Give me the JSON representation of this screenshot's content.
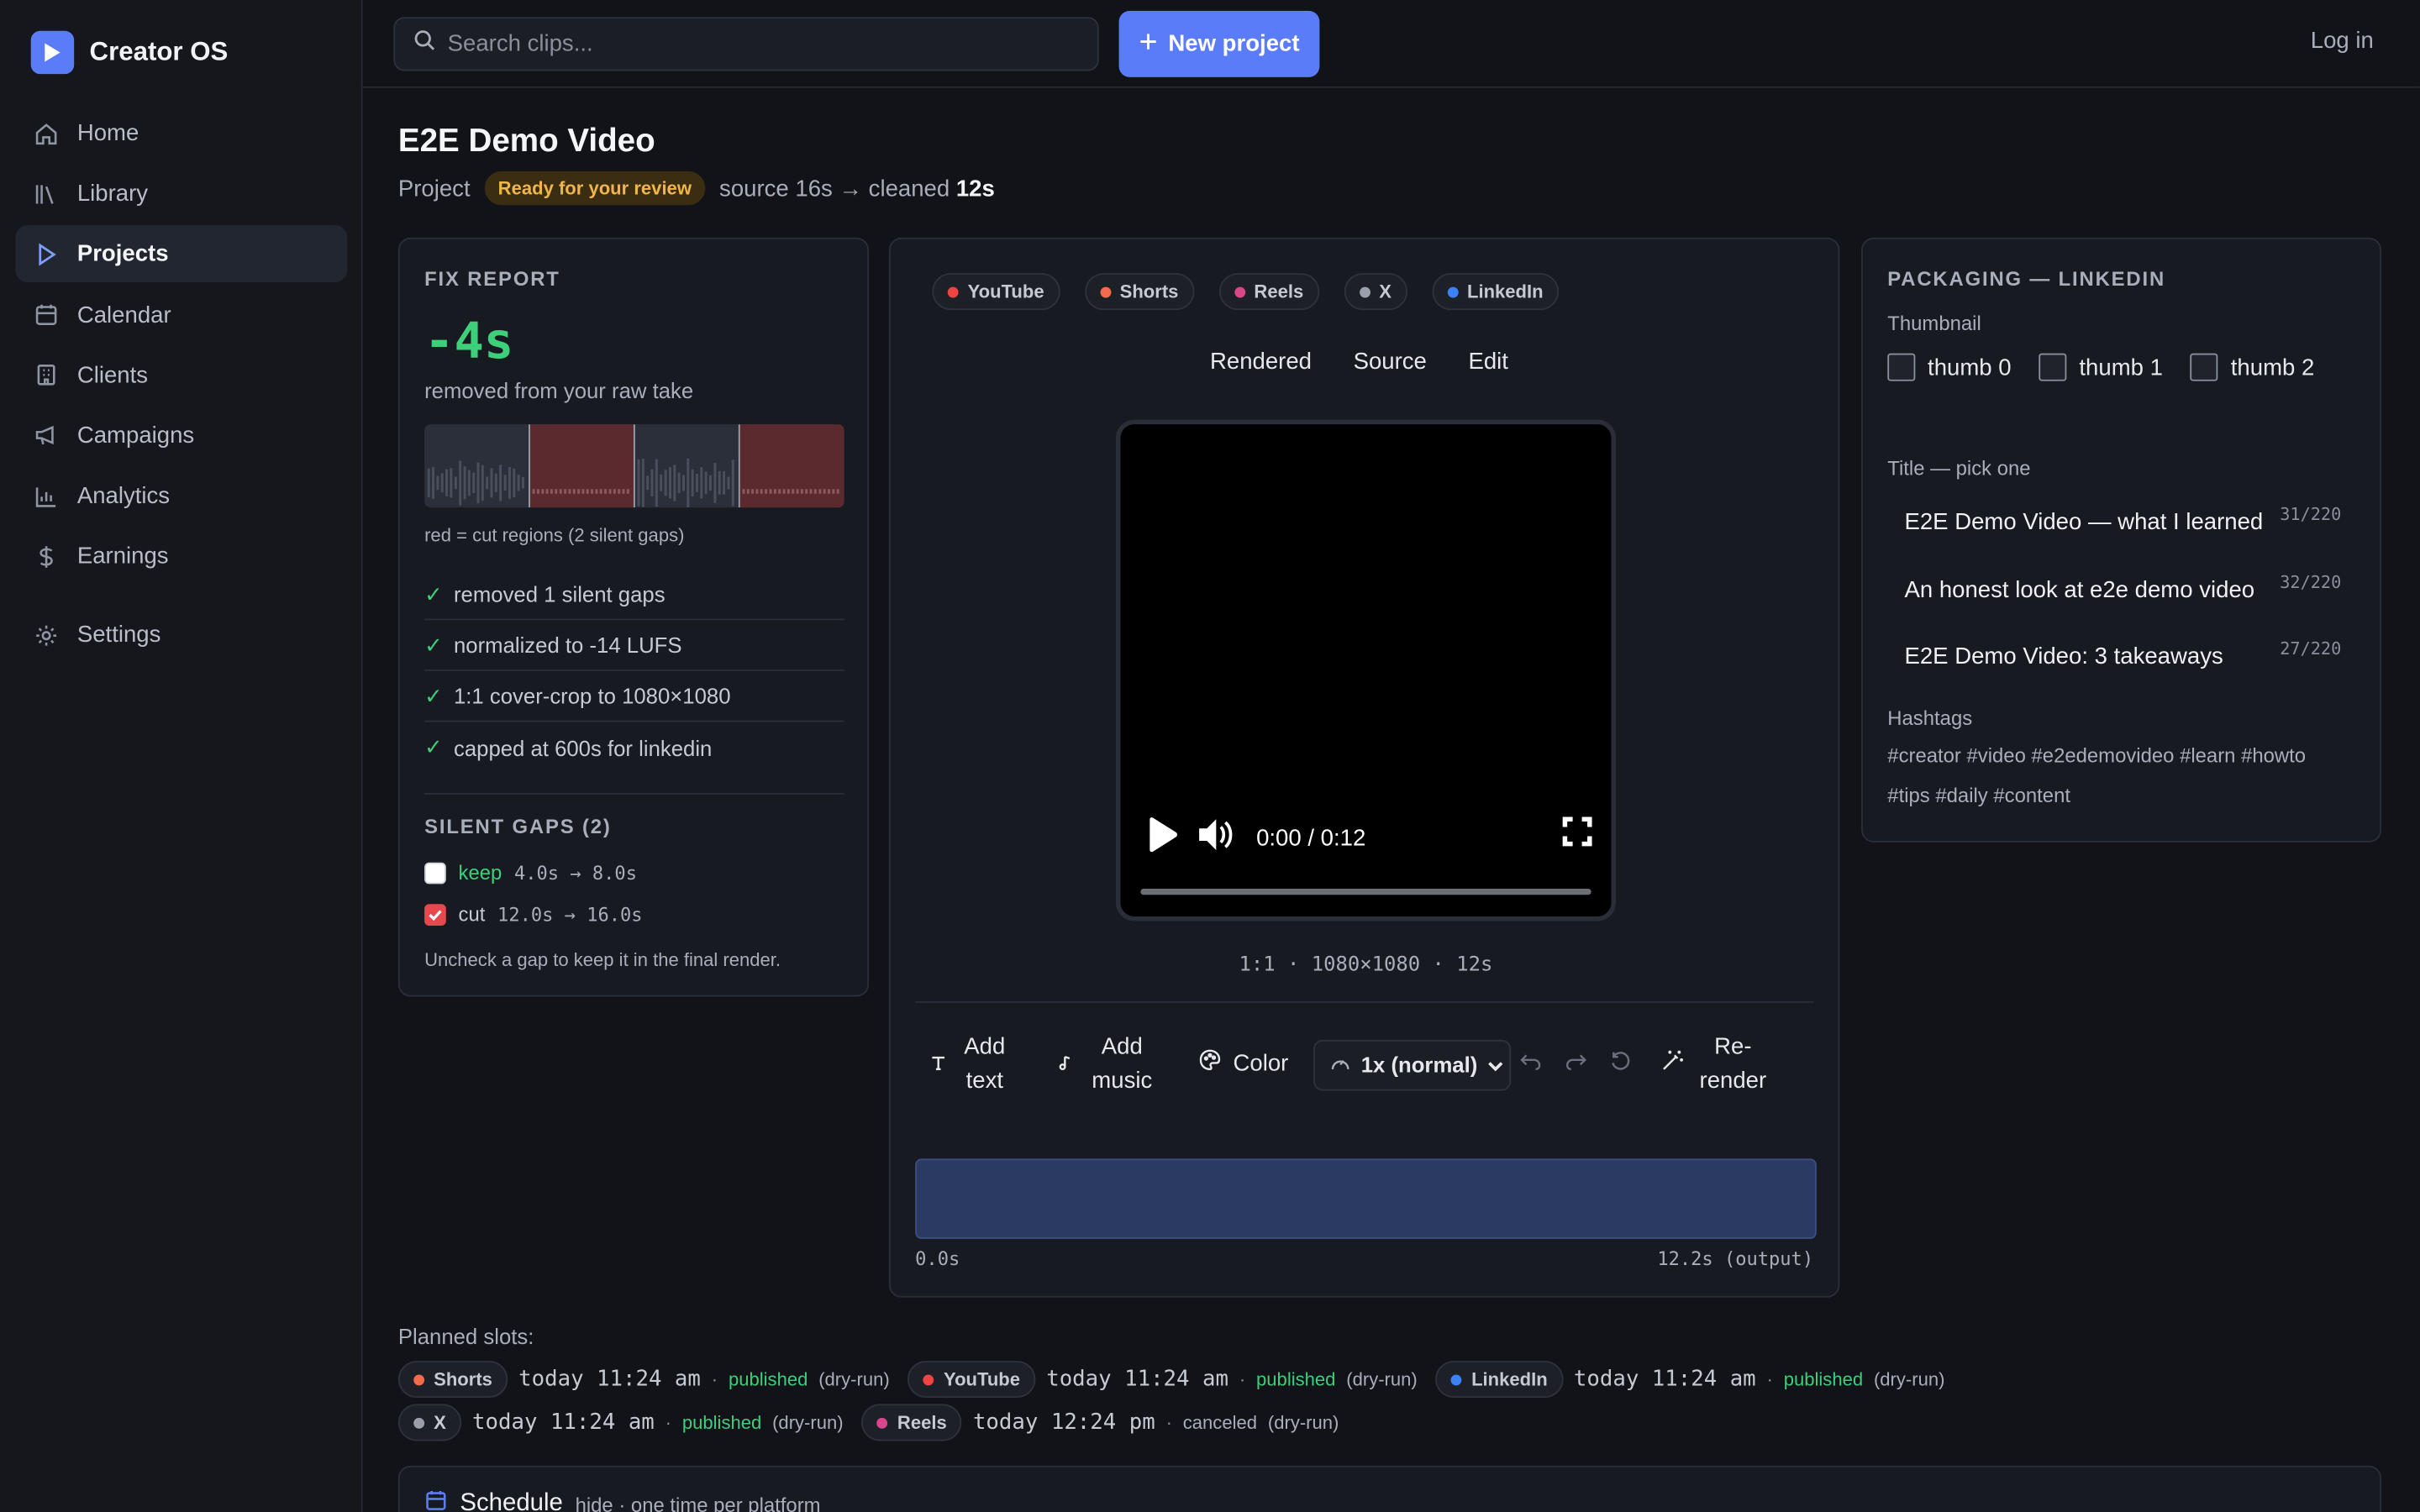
{
  "app": {
    "name": "Creator OS"
  },
  "sidebar": {
    "items": [
      {
        "label": "Home",
        "icon": "home-icon"
      },
      {
        "label": "Library",
        "icon": "library-icon"
      },
      {
        "label": "Projects",
        "icon": "play-icon",
        "active": true
      },
      {
        "label": "Calendar",
        "icon": "calendar-icon"
      },
      {
        "label": "Clients",
        "icon": "building-icon"
      },
      {
        "label": "Campaigns",
        "icon": "megaphone-icon"
      },
      {
        "label": "Analytics",
        "icon": "bar-chart-icon"
      },
      {
        "label": "Earnings",
        "icon": "dollar-icon"
      },
      {
        "label": "Settings",
        "icon": "gear-icon"
      }
    ]
  },
  "topbar": {
    "search_placeholder": "Search clips...",
    "new_project": "New project",
    "login": "Log in"
  },
  "project": {
    "title": "E2E Demo Video",
    "kind": "Project",
    "status": "Ready for your review",
    "duration_prefix": "source 16s → cleaned",
    "duration_clean": "12s"
  },
  "fix_report": {
    "heading": "FIX REPORT",
    "delta": "-4s",
    "delta_note": "removed from your raw take",
    "wave_note": "red = cut regions (2 silent gaps)",
    "checks": [
      "removed 1 silent gaps",
      "normalized to -14 LUFS",
      "1:1 cover-crop to 1080×1080",
      "capped at 600s for linkedin"
    ],
    "gaps_heading": "SILENT GAPS (2)",
    "gaps": [
      {
        "label": "keep",
        "range": "4.0s → 8.0s",
        "checked": false
      },
      {
        "label": "cut",
        "range": "12.0s → 16.0s",
        "checked": true
      }
    ],
    "gaps_hint": "Uncheck a gap to keep it in the final render."
  },
  "player": {
    "platforms": [
      {
        "label": "YouTube",
        "color": "#ef4444"
      },
      {
        "label": "Shorts",
        "color": "#f26b4a"
      },
      {
        "label": "Reels",
        "color": "#d9468a"
      },
      {
        "label": "X",
        "color": "#9aa0ab"
      },
      {
        "label": "LinkedIn",
        "color": "#3b82f6"
      }
    ],
    "view_tabs": [
      "Rendered",
      "Source",
      "Edit"
    ],
    "time": "0:00 / 0:12",
    "meta": "1:1 · 1080×1080 · 12s",
    "tools": {
      "add_text": "Add text",
      "add_music": "Add music",
      "color": "Color",
      "speed": "1x (normal)",
      "rerender": "Re-render"
    },
    "timeline_start": "0.0s",
    "timeline_end": "12.2s (output)"
  },
  "packaging": {
    "heading": "PACKAGING — LINKEDIN",
    "thumb_label": "Thumbnail",
    "thumbs": [
      "thumb 0",
      "thumb 1",
      "thumb 2"
    ],
    "title_label": "Title — pick one",
    "titles": [
      {
        "text": "E2E Demo Video — what I learned",
        "count": "31/220"
      },
      {
        "text": "An honest look at e2e demo video",
        "count": "32/220"
      },
      {
        "text": "E2E Demo Video: 3 takeaways",
        "count": "27/220"
      }
    ],
    "hashtags_label": "Hashtags",
    "hashtags": "#creator #video #e2edemovideo #learn #howto #tips #daily #content"
  },
  "planned": {
    "label": "Planned slots:",
    "slots": [
      {
        "platform": "Shorts",
        "color": "#f26b4a",
        "time": "today 11:24 am",
        "status": "published",
        "note": "(dry-run)"
      },
      {
        "platform": "YouTube",
        "color": "#ef4444",
        "time": "today 11:24 am",
        "status": "published",
        "note": "(dry-run)"
      },
      {
        "platform": "LinkedIn",
        "color": "#3b82f6",
        "time": "today 11:24 am",
        "status": "published",
        "note": "(dry-run)"
      },
      {
        "platform": "X",
        "color": "#9aa0ab",
        "time": "today 11:24 am",
        "status": "published",
        "note": "(dry-run)"
      },
      {
        "platform": "Reels",
        "color": "#d9468a",
        "time": "today 12:24 pm",
        "status": "canceled",
        "note": "(dry-run)"
      }
    ]
  },
  "schedule": {
    "title": "Schedule",
    "subtitle": "hide · one time per platform"
  }
}
